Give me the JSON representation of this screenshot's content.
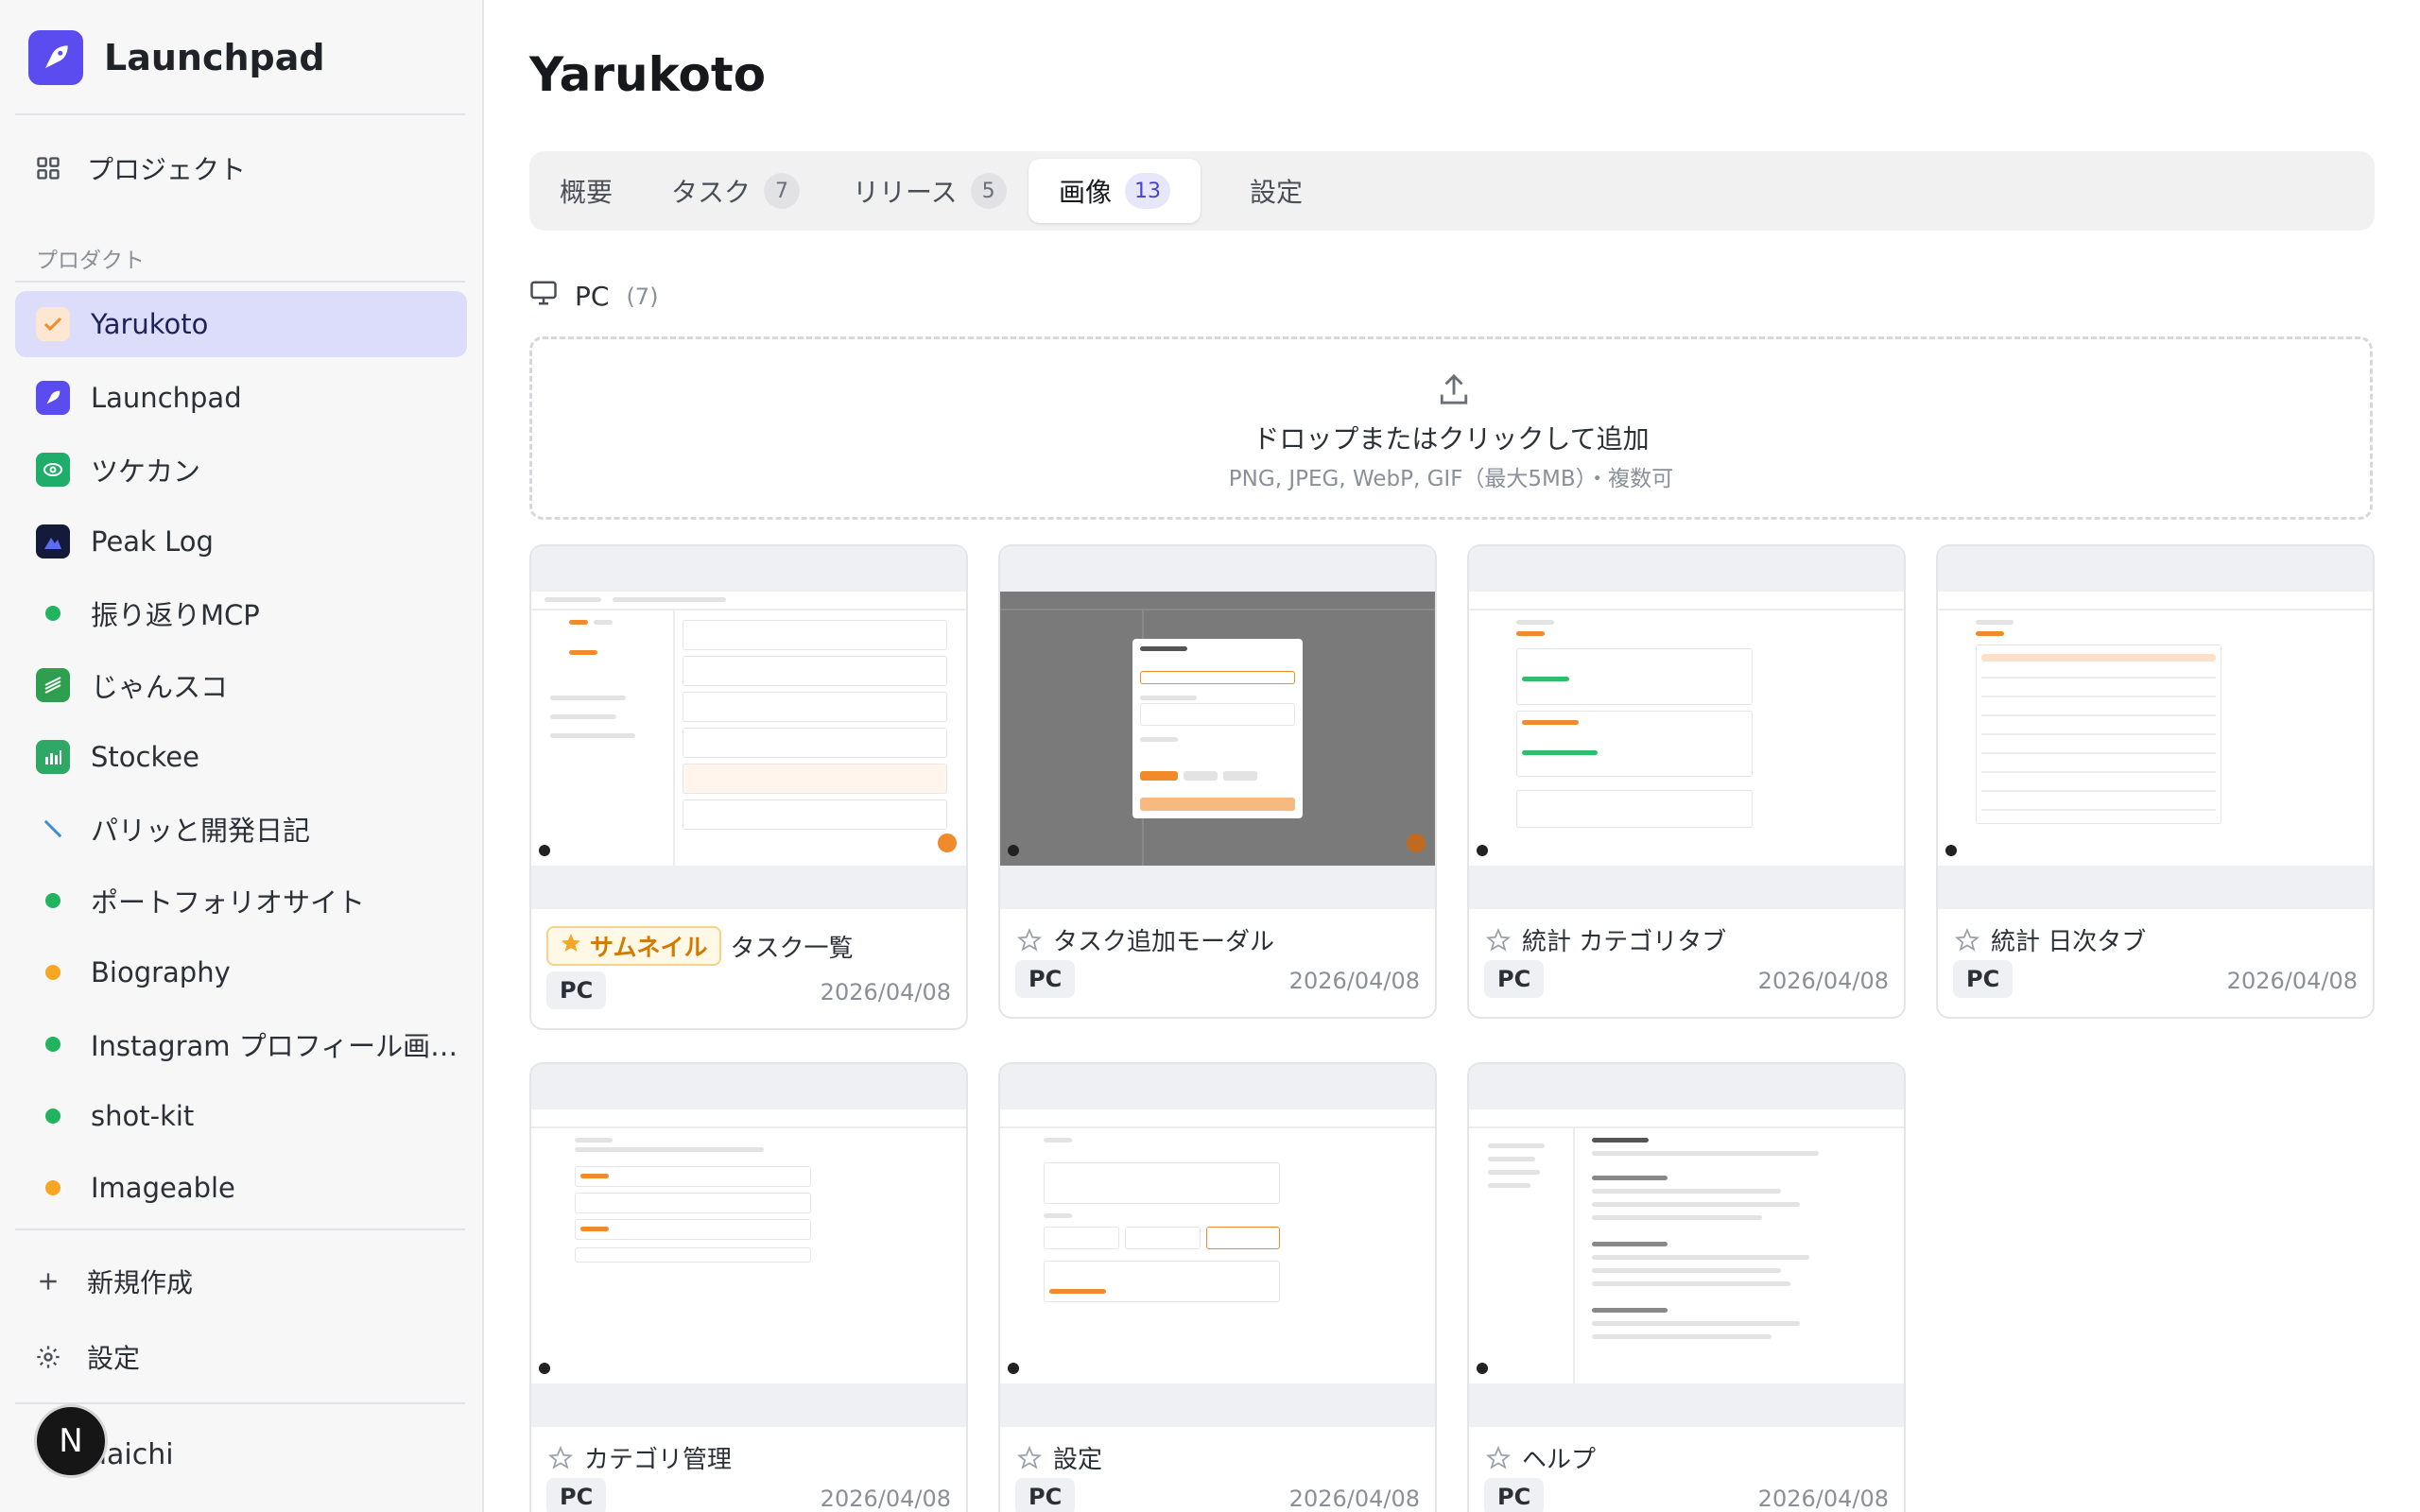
{
  "app": {
    "name": "Launchpad",
    "brand_color": "#5b4cf0"
  },
  "sidebar": {
    "projects_label": "プロジェクト",
    "section_label": "プロダクト",
    "items": [
      {
        "label": "Yarukoto",
        "icon": "yarukoto-icon",
        "active": true
      },
      {
        "label": "Launchpad",
        "icon": "launchpad-icon"
      },
      {
        "label": "ツケカン",
        "icon": "tsukekan-icon"
      },
      {
        "label": "Peak Log",
        "icon": "peaklog-icon"
      },
      {
        "label": "振り返りMCP",
        "icon": "status-dot",
        "color": "#22b35e"
      },
      {
        "label": "じゃんスコ",
        "icon": "jansco-icon"
      },
      {
        "label": "Stockee",
        "icon": "stockee-icon"
      },
      {
        "label": "パリッと開発日記",
        "icon": "pen-icon"
      },
      {
        "label": "ポートフォリオサイト",
        "icon": "status-dot",
        "color": "#22b35e"
      },
      {
        "label": "Biography",
        "icon": "status-dot",
        "color": "#f5a623"
      },
      {
        "label": "Instagram プロフィール画…",
        "icon": "status-dot",
        "color": "#22b35e"
      },
      {
        "label": "shot-kit",
        "icon": "status-dot",
        "color": "#22b35e"
      },
      {
        "label": "Imageable",
        "icon": "status-dot",
        "color": "#f5a623"
      }
    ],
    "new_label": "新規作成",
    "settings_label": "設定",
    "user_initial": "N",
    "user_name": "daichi"
  },
  "main": {
    "title": "Yarukoto",
    "tabs": [
      {
        "label": "概要"
      },
      {
        "label": "タスク",
        "count": "7"
      },
      {
        "label": "リリース",
        "count": "5"
      },
      {
        "label": "画像",
        "count": "13",
        "active": true
      },
      {
        "label": "設定"
      }
    ],
    "section": {
      "label": "PC",
      "count": "(7)"
    },
    "dropzone": {
      "text": "ドロップまたはクリックして追加",
      "sub": "PNG, JPEG, WebP, GIF（最大5MB）・複数可"
    },
    "thumbnail_badge": "サムネイル",
    "cards": [
      {
        "title": "タスク一覧",
        "tag": "PC",
        "date": "2026/04/08",
        "thumbnail": true
      },
      {
        "title": "タスク追加モーダル",
        "tag": "PC",
        "date": "2026/04/08"
      },
      {
        "title": "統計 カテゴリタブ",
        "tag": "PC",
        "date": "2026/04/08"
      },
      {
        "title": "統計 日次タブ",
        "tag": "PC",
        "date": "2026/04/08"
      },
      {
        "title": "カテゴリ管理",
        "tag": "PC",
        "date": "2026/04/08"
      },
      {
        "title": "設定",
        "tag": "PC",
        "date": "2026/04/08"
      },
      {
        "title": "ヘルプ",
        "tag": "PC",
        "date": "2026/04/08"
      }
    ]
  }
}
